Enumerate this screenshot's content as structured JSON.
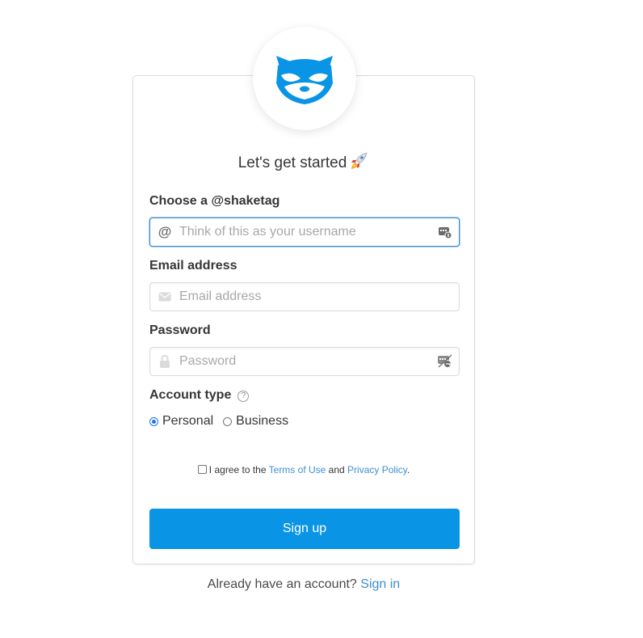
{
  "heading": "Let's get started",
  "form": {
    "shaketag": {
      "label": "Choose a @shaketag",
      "placeholder": "Think of this as your username",
      "value": ""
    },
    "email": {
      "label": "Email address",
      "placeholder": "Email address",
      "value": ""
    },
    "password": {
      "label": "Password",
      "placeholder": "Password",
      "value": ""
    },
    "account_type": {
      "label": "Account type",
      "help_glyph": "?",
      "options": [
        {
          "label": "Personal",
          "checked": true
        },
        {
          "label": "Business",
          "checked": false
        }
      ]
    },
    "agree": {
      "prefix": "I agree to the",
      "terms_link": "Terms of Use",
      "and": "and",
      "privacy_link": "Privacy Policy",
      "suffix": ".",
      "checked": false
    },
    "submit_label": "Sign up"
  },
  "footer": {
    "prompt": "Already have an account?",
    "signin_link": "Sign in"
  },
  "colors": {
    "brand_blue": "#0a94e6",
    "link_blue": "#3e8ed0",
    "focus_border": "#3e8ed0"
  },
  "icons": {
    "logo": "raccoon-logo-icon",
    "rocket": "rocket-icon",
    "shaketag_left": "at-sign-icon",
    "email_left": "envelope-icon",
    "password_left": "lock-icon",
    "shaketag_right": "password-manager-icon",
    "password_right": "password-manager-key-icon",
    "help": "question-circle-icon"
  }
}
